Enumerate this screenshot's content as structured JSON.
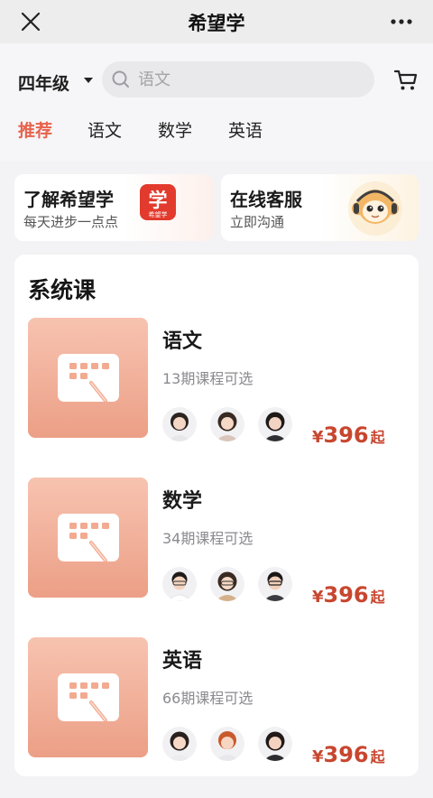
{
  "topbar": {
    "title": "希望学",
    "close_icon": "close-icon",
    "more_icon": "more-dots-icon"
  },
  "header": {
    "grade": "四年级",
    "search_placeholder": "语文",
    "cart_icon": "cart-icon"
  },
  "tabs": [
    {
      "label": "推荐",
      "active": true
    },
    {
      "label": "语文",
      "active": false
    },
    {
      "label": "数学",
      "active": false
    },
    {
      "label": "英语",
      "active": false
    }
  ],
  "promos": [
    {
      "title": "了解希望学",
      "subtitle": "每天进步一点点",
      "badge_char": "学",
      "badge_caption": "希望学"
    },
    {
      "title": "在线客服",
      "subtitle": "立即沟通"
    }
  ],
  "section": {
    "title": "系统课",
    "courses": [
      {
        "name": "语文",
        "count": "13期课程可选",
        "currency": "¥",
        "price": "396",
        "suffix": "起"
      },
      {
        "name": "数学",
        "count": "34期课程可选",
        "currency": "¥",
        "price": "396",
        "suffix": "起"
      },
      {
        "name": "英语",
        "count": "66期课程可选",
        "currency": "¥",
        "price": "396",
        "suffix": "起"
      }
    ]
  },
  "colors": {
    "accent": "#e7644d",
    "price": "#c8462f",
    "thumb_top": "#f7c3b0",
    "thumb_bottom": "#ec9f86"
  }
}
